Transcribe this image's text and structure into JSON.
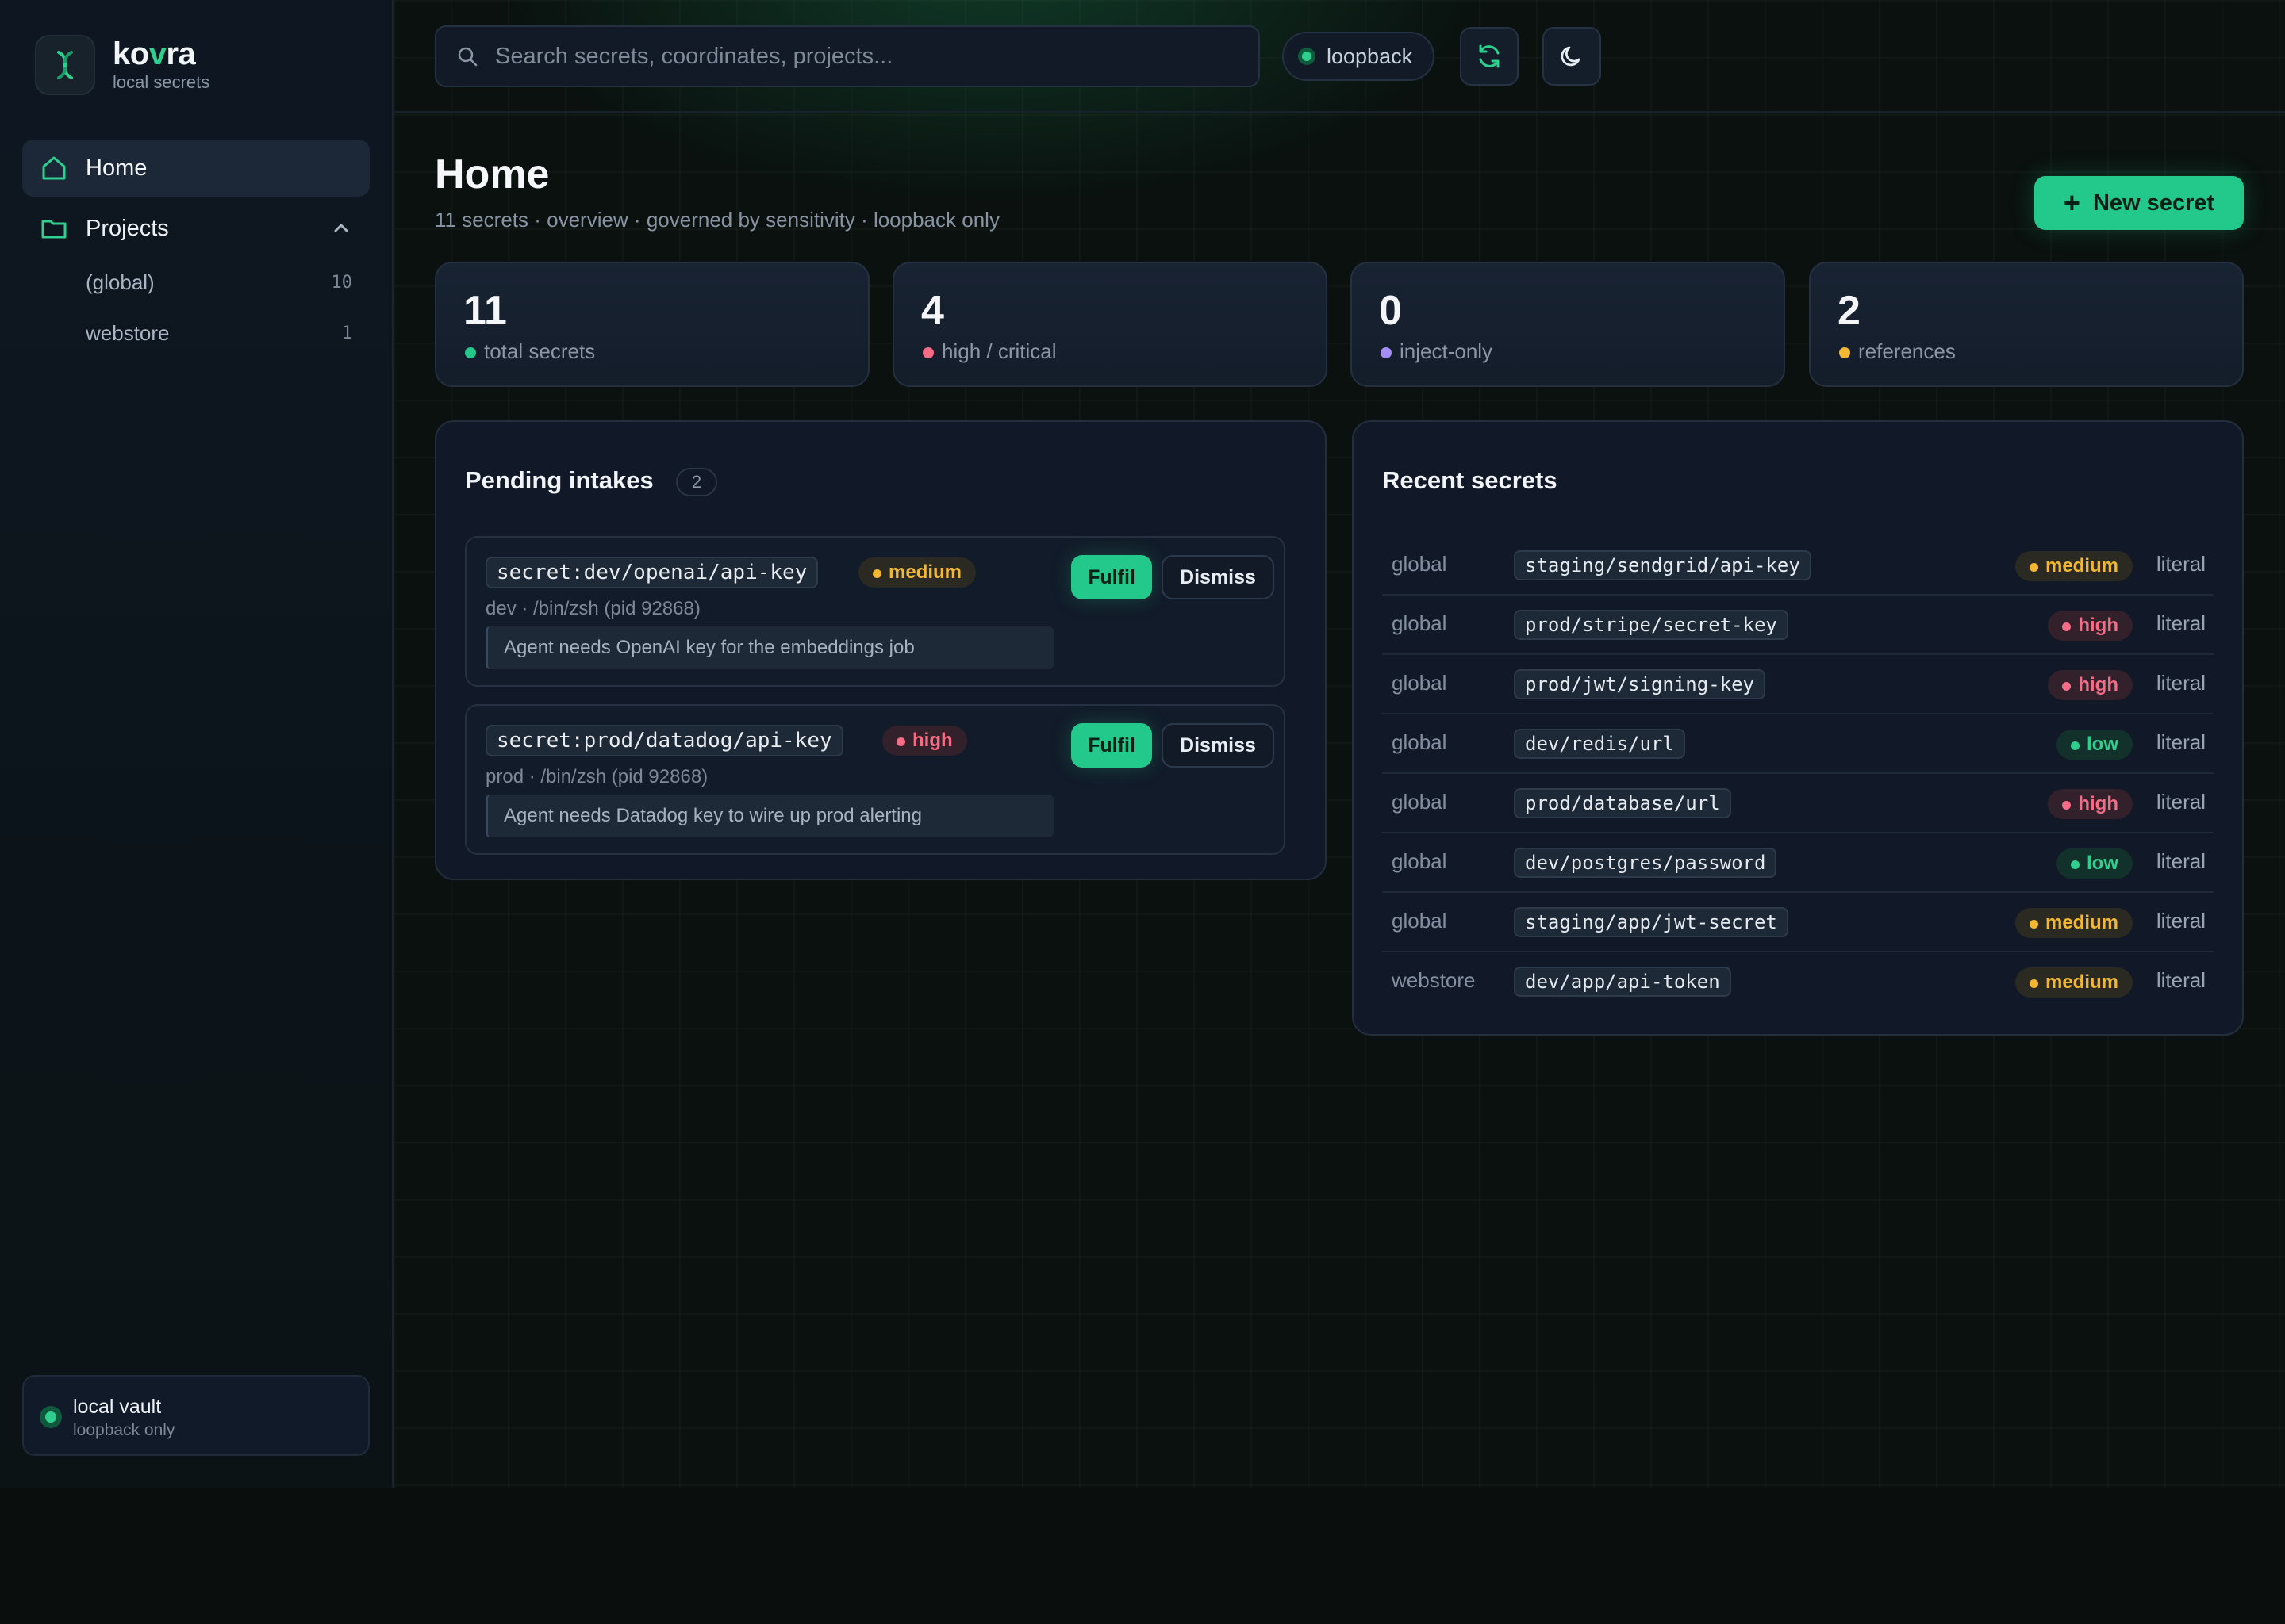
{
  "brand": {
    "name_pre": "ko",
    "name_acc": "v",
    "name_post": "ra",
    "subtitle": "local secrets"
  },
  "sidebar": {
    "home_label": "Home",
    "projects_label": "Projects",
    "projects": [
      {
        "label": "(global)",
        "count": "10"
      },
      {
        "label": "webstore",
        "count": "1"
      }
    ],
    "vault": {
      "title": "local vault",
      "subtitle": "loopback only"
    }
  },
  "topbar": {
    "search_placeholder": "Search secrets, coordinates, projects...",
    "status_label": "loopback",
    "icons": [
      "refresh-icon",
      "moon-icon"
    ]
  },
  "page": {
    "title": "Home",
    "subtitle": "11 secrets · overview · governed by sensitivity · loopback only",
    "new_button": "New secret"
  },
  "stats": [
    {
      "value": "11",
      "label": "total secrets",
      "color": "#22c98a"
    },
    {
      "value": "4",
      "label": "high / critical",
      "color": "#f46c86"
    },
    {
      "value": "0",
      "label": "inject-only",
      "color": "#a68cf5"
    },
    {
      "value": "2",
      "label": "references",
      "color": "#f2b733"
    }
  ],
  "intakes": {
    "title": "Pending intakes",
    "count": "2",
    "fulfil_label": "Fulfil",
    "dismiss_label": "Dismiss",
    "items": [
      {
        "coordinate": "secret:dev/openai/api-key",
        "severity": "medium",
        "meta": "dev · /bin/zsh (pid 92868)",
        "note": "Agent needs OpenAI key for the embeddings job"
      },
      {
        "coordinate": "secret:prod/datadog/api-key",
        "severity": "high",
        "meta": "prod · /bin/zsh (pid 92868)",
        "note": "Agent needs Datadog key to wire up prod alerting"
      }
    ]
  },
  "recent": {
    "title": "Recent secrets",
    "rows": [
      {
        "project": "global",
        "coordinate": "staging/sendgrid/api-key",
        "severity": "medium",
        "kind": "literal"
      },
      {
        "project": "global",
        "coordinate": "prod/stripe/secret-key",
        "severity": "high",
        "kind": "literal"
      },
      {
        "project": "global",
        "coordinate": "prod/jwt/signing-key",
        "severity": "high",
        "kind": "literal"
      },
      {
        "project": "global",
        "coordinate": "dev/redis/url",
        "severity": "low",
        "kind": "literal"
      },
      {
        "project": "global",
        "coordinate": "prod/database/url",
        "severity": "high",
        "kind": "literal"
      },
      {
        "project": "global",
        "coordinate": "dev/postgres/password",
        "severity": "low",
        "kind": "literal"
      },
      {
        "project": "global",
        "coordinate": "staging/app/jwt-secret",
        "severity": "medium",
        "kind": "literal"
      },
      {
        "project": "webstore",
        "coordinate": "dev/app/api-token",
        "severity": "medium",
        "kind": "literal"
      }
    ]
  },
  "colors": {
    "accent": "#22c98a",
    "high": "#f46c86",
    "medium": "#f2b733",
    "low": "#2ecf8f"
  }
}
